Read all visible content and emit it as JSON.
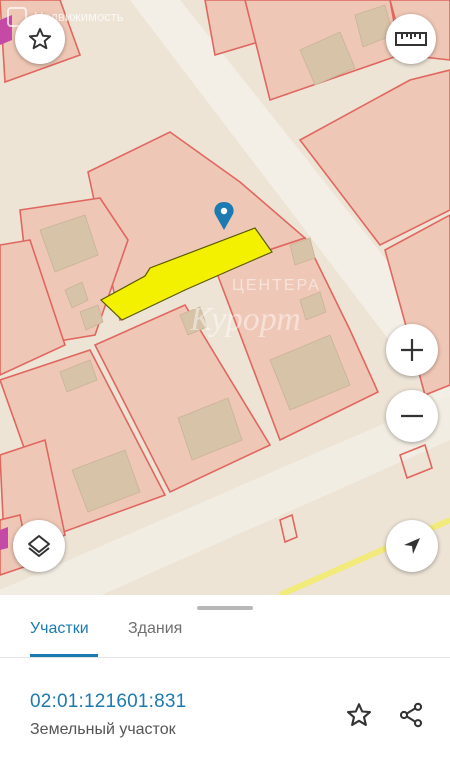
{
  "map": {
    "watermark_label": "Недвижимость",
    "buttons": {
      "favorite": "star-icon",
      "ruler": "ruler-icon",
      "zoom_in": "plus-icon",
      "zoom_out": "minus-icon",
      "layers": "layers-icon",
      "locate": "navigation-arrow-icon"
    },
    "colors": {
      "background": "#ede4d6",
      "parcel_fill": "#efc7b6",
      "parcel_border": "#e0675f",
      "building": "#d6c3a8",
      "road": "#f3eee4",
      "selected_parcel": "#f3f000",
      "marker": "#1c7ab2"
    }
  },
  "tabs": [
    {
      "label": "Участки",
      "active": true
    },
    {
      "label": "Здания",
      "active": false
    }
  ],
  "parcel": {
    "cadastral_number": "02:01:121601:831",
    "type": "Земельный участок"
  },
  "actions": {
    "favorite_icon": "star-icon",
    "share_icon": "share-icon"
  }
}
